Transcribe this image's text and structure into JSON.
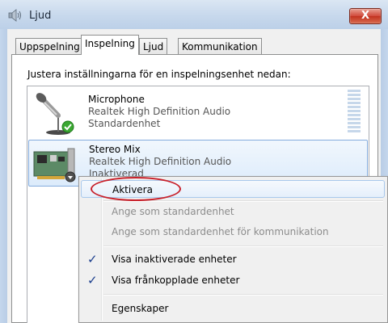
{
  "window": {
    "title": "Ljud",
    "icon": "speaker-icon",
    "close_glyph": "X"
  },
  "tabs": [
    {
      "label": "Uppspelning",
      "active": false
    },
    {
      "label": "Inspelning",
      "active": true
    },
    {
      "label": "Ljud",
      "active": false
    },
    {
      "label": "Kommunikation",
      "active": false
    }
  ],
  "panel": {
    "instruction": "Justera inställningarna för en inspelningsenhet nedan:"
  },
  "devices": [
    {
      "name": "Microphone",
      "driver": "Realtek High Definition Audio",
      "status": "Standardenhet",
      "icon": "microphone-icon",
      "badge": "green-check-badge",
      "selected": false
    },
    {
      "name": "Stereo Mix",
      "driver": "Realtek High Definition Audio",
      "status": "Inaktiverad",
      "icon": "sound-card-icon",
      "badge": "disabled-arrow-badge",
      "selected": true
    }
  ],
  "context_menu": {
    "items": [
      {
        "label": "Aktivera",
        "enabled": true,
        "highlighted": true,
        "checked": false
      },
      {
        "label": "Ange som standardenhet",
        "enabled": false,
        "checked": false
      },
      {
        "label": "Ange som standardenhet för kommunikation",
        "enabled": false,
        "checked": false
      },
      {
        "label": "Visa inaktiverade enheter",
        "enabled": true,
        "checked": true
      },
      {
        "label": "Visa frånkopplade enheter",
        "enabled": true,
        "checked": true
      },
      {
        "label": "Egenskaper",
        "enabled": true,
        "checked": false
      }
    ],
    "check_glyph": "✓"
  },
  "colors": {
    "annotation_oval": "#c8202a",
    "selection_border": "#84acdd",
    "check_mark": "#1a3d8c",
    "ok_badge": "#3aa832"
  }
}
